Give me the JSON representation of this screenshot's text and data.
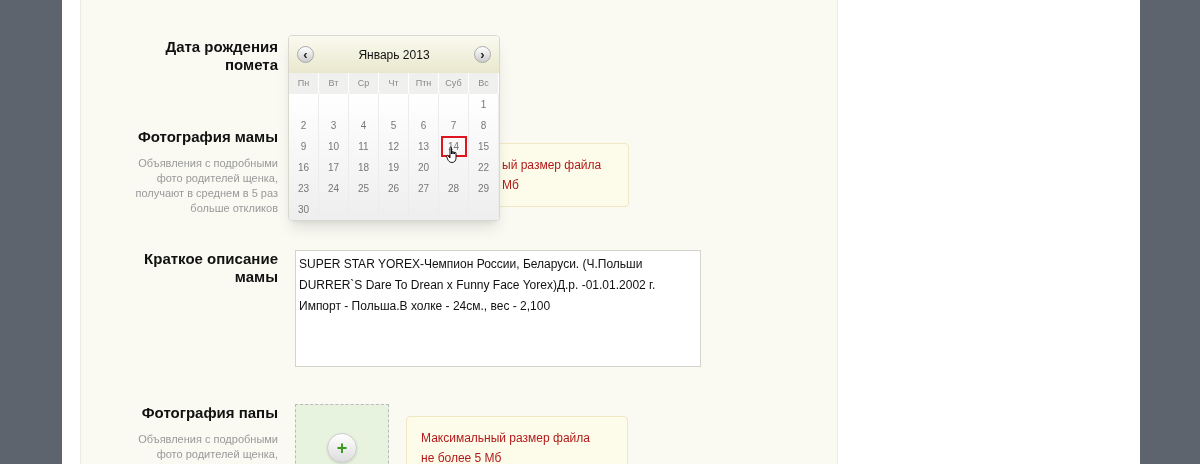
{
  "form": {
    "rows": [
      {
        "kind": "date",
        "label": "Дата рождения помета"
      },
      {
        "kind": "photo",
        "label": "Фотография мамы",
        "hint": "Объявления с подробными фото родителей щенка, получают в среднем в 5 раз больше откликов",
        "tooltip": [
          "ый размер файла",
          "Мб"
        ]
      },
      {
        "kind": "text",
        "label": "Краткое описание мамы",
        "value": "SUPER STAR YOREX-Чемпион России, Беларуси. (Ч.Польши DURRER`S Dare To Drean x Funny Face Yorex)Д.р. -01.01.2002 г. Импорт - Польша.В холке - 24см., вес - 2,100"
      },
      {
        "kind": "photo",
        "label": "Фотография папы",
        "hint": "Объявления с подробными фото родителей щенка,",
        "tooltip": [
          "Максимальный размер файла",
          "не более 5 Мб"
        ],
        "add_button": "+"
      }
    ]
  },
  "calendar": {
    "month": "Январь 2013",
    "prev": "‹",
    "next": "›",
    "weekdays": [
      "Пн",
      "Вт",
      "Ср",
      "Чт",
      "Птн",
      "Суб",
      "Вс"
    ],
    "days": [
      {
        "label": "1",
        "selected": false
      },
      {
        "label": "2",
        "selected": false
      },
      {
        "label": "3",
        "selected": false
      },
      {
        "label": "4",
        "selected": false
      },
      {
        "label": "5",
        "selected": false
      },
      {
        "label": "6",
        "selected": false
      },
      {
        "label": "7",
        "selected": false
      },
      {
        "label": "8",
        "selected": false
      },
      {
        "label": "9",
        "selected": false
      },
      {
        "label": "10",
        "selected": false
      },
      {
        "label": "11",
        "selected": false
      },
      {
        "label": "12",
        "selected": false
      },
      {
        "label": "13",
        "selected": false
      },
      {
        "label": "14",
        "selected": true
      },
      {
        "label": "15",
        "selected": false
      },
      {
        "label": "16",
        "selected": false
      },
      {
        "label": "17",
        "selected": false
      },
      {
        "label": "18",
        "selected": false
      },
      {
        "label": "19",
        "selected": false
      },
      {
        "label": "20",
        "selected": false
      },
      {
        "selected": false
      },
      {
        "label": "22",
        "selected": false
      },
      {
        "label": "23",
        "selected": false
      },
      {
        "label": "24",
        "selected": false
      },
      {
        "label": "25",
        "selected": false
      },
      {
        "label": "26",
        "selected": false
      },
      {
        "label": "27",
        "selected": false
      },
      {
        "label": "28",
        "selected": false
      },
      {
        "label": "29",
        "selected": false
      },
      {
        "label": "30",
        "selected": false
      }
    ]
  }
}
